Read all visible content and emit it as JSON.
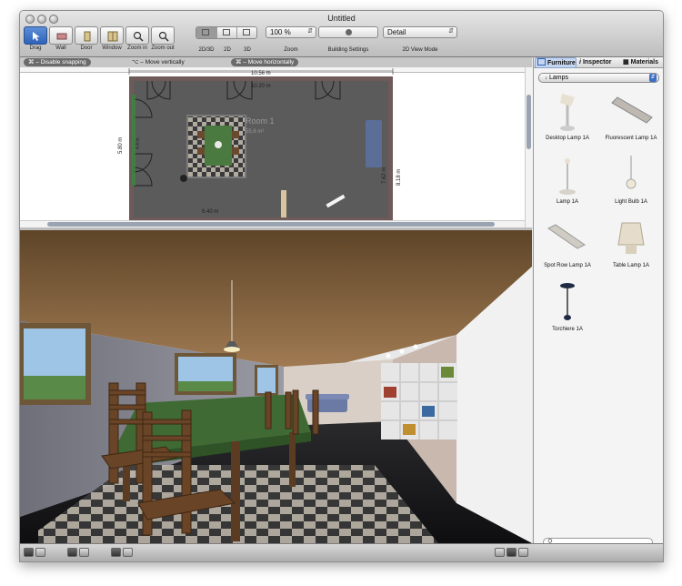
{
  "window": {
    "title": "Untitled"
  },
  "toolbar": {
    "tools": [
      {
        "id": "drag",
        "label": "Drag",
        "icon": "arrow-pointer-icon"
      },
      {
        "id": "wall",
        "label": "Wall",
        "icon": "wall-icon"
      },
      {
        "id": "door",
        "label": "Door",
        "icon": "door-icon"
      },
      {
        "id": "window",
        "label": "Window",
        "icon": "window-icon"
      },
      {
        "id": "zoom_in",
        "label": "Zoom in",
        "icon": "zoom-in-icon"
      },
      {
        "id": "zoom_out",
        "label": "Zoom out",
        "icon": "zoom-out-icon"
      }
    ],
    "view_modes": [
      "2D/3D",
      "2D",
      "3D"
    ],
    "zoom": {
      "value": "100 %",
      "label": "Zoom"
    },
    "building_settings_label": "Building Settings",
    "view_2d_mode": {
      "value": "Detail",
      "label": "2D View Mode"
    }
  },
  "hints": {
    "snapping": "⌘ – Disable snapping",
    "vertical": "⌥ – Move vertically",
    "horizontal": "⌘ – Move horizontally"
  },
  "plan": {
    "dimensions": {
      "overall_width": "10.56 m",
      "top_inner": "10.20 m",
      "left_height": "5.80 m",
      "right_inner": "7.62 m",
      "right_outer": "8.18 m",
      "bottom_segment": "6.40 m",
      "small_left": "4.4 m"
    },
    "room": {
      "name": "Room 1",
      "area": "55.6 m²"
    }
  },
  "panel": {
    "tabs": [
      "Furniture",
      "Inspector",
      "Materials"
    ],
    "category": "Lamps",
    "items": [
      {
        "name": "Desktop Lamp 1A"
      },
      {
        "name": "Fluorescent Lamp 1A"
      },
      {
        "name": "Lamp 1A"
      },
      {
        "name": "Light Bulb 1A"
      },
      {
        "name": "Spot Row Lamp 1A"
      },
      {
        "name": "Table Lamp 1A"
      },
      {
        "name": "Torchiere 1A"
      }
    ],
    "search": {
      "value": ""
    }
  },
  "colors": {
    "accent": "#2f63b8",
    "floor_plan_wall": "#5a4a48",
    "floor_plan_floor": "#5b5b5b",
    "ceiling": "#8a6a46",
    "rug": "#4a7a3f"
  }
}
